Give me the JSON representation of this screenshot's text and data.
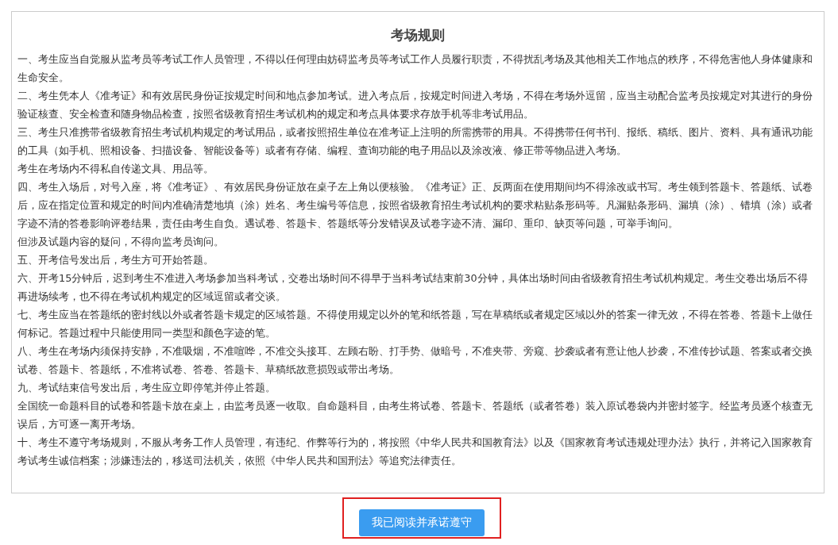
{
  "title": "考场规则",
  "paragraphs": [
    "一、考生应当自觉服从监考员等考试工作人员管理，不得以任何理由妨碍监考员等考试工作人员履行职责，不得扰乱考场及其他相关工作地点的秩序，不得危害他人身体健康和生命安全。",
    "二、考生凭本人《准考证》和有效居民身份证按规定时间和地点参加考试。进入考点后，按规定时间进入考场，不得在考场外逗留，应当主动配合监考员按规定对其进行的身份验证核查、安全检查和随身物品检查，按照省级教育招生考试机构的规定和考点具体要求存放手机等非考试用品。",
    "三、考生只准携带省级教育招生考试机构规定的考试用品，或者按照招生单位在准考证上注明的所需携带的用具。不得携带任何书刊、报纸、稿纸、图片、资料、具有通讯功能的工具（如手机、照相设备、扫描设备、智能设备等）或者有存储、编程、查询功能的电子用品以及涂改液、修正带等物品进入考场。",
    "考生在考场内不得私自传递文具、用品等。",
    "四、考生入场后，对号入座，将《准考证》、有效居民身份证放在桌子左上角以便核验。《准考证》正、反两面在使用期间均不得涂改或书写。考生领到答题卡、答题纸、试卷后，应在指定位置和规定的时间内准确清楚地填（涂）姓名、考生编号等信息，按照省级教育招生考试机构的要求粘贴条形码等。凡漏贴条形码、漏填（涂）、错填（涂）或者字迹不清的答卷影响评卷结果，责任由考生自负。遇试卷、答题卡、答题纸等分发错误及试卷字迹不清、漏印、重印、缺页等问题，可举手询问。",
    "但涉及试题内容的疑问，不得向监考员询问。",
    "五、开考信号发出后，考生方可开始答题。",
    "六、开考15分钟后，迟到考生不准进入考场参加当科考试，交卷出场时间不得早于当科考试结束前30分钟，具体出场时间由省级教育招生考试机构规定。考生交卷出场后不得再进场续考，也不得在考试机构规定的区域逗留或者交谈。",
    "七、考生应当在答题纸的密封线以外或者答题卡规定的区域答题。不得使用规定以外的笔和纸答题，写在草稿纸或者规定区域以外的答案一律无效，不得在答卷、答题卡上做任何标记。答题过程中只能使用同一类型和颜色字迹的笔。",
    "八、考生在考场内须保持安静，不准吸烟，不准喧哗，不准交头接耳、左顾右盼、打手势、做暗号，不准夹带、旁窥、抄袭或者有意让他人抄袭，不准传抄试题、答案或者交换试卷、答题卡、答题纸，不准将试卷、答卷、答题卡、草稿纸故意损毁或带出考场。",
    "九、考试结束信号发出后，考生应立即停笔并停止答题。",
    "全国统一命题科目的试卷和答题卡放在桌上，由监考员逐一收取。自命题科目，由考生将试卷、答题卡、答题纸（或者答卷）装入原试卷袋内并密封签字。经监考员逐个核查无误后，方可逐一离开考场。",
    "十、考生不遵守考场规则，不服从考务工作人员管理，有违纪、作弊等行为的，将按照《中华人民共和国教育法》以及《国家教育考试违规处理办法》执行，并将记入国家教育考试考生诚信档案；涉嫌违法的，移送司法机关，依照《中华人民共和国刑法》等追究法律责任。"
  ],
  "confirm_button": {
    "label": "我已阅读并承诺遵守"
  }
}
